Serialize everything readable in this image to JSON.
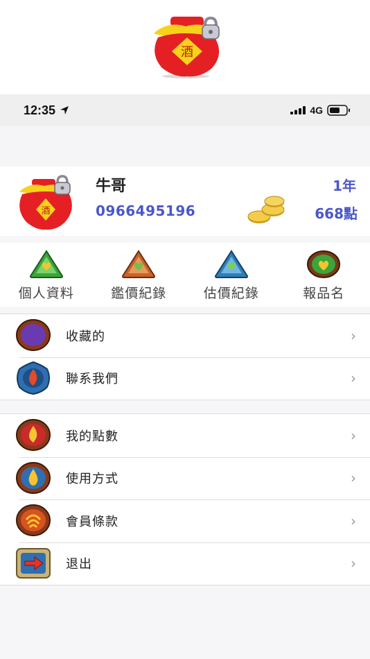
{
  "logo": {
    "glyph": "酒",
    "icon": "wine-jar-logo-icon"
  },
  "status_bar": {
    "time": "12:35",
    "network": "4G"
  },
  "profile": {
    "name": "牛哥",
    "membership": "1年",
    "phone": "0966495196",
    "points": "668點"
  },
  "quick_actions": [
    {
      "label": "個人資料",
      "icon": "green-triangle-badge-icon"
    },
    {
      "label": "鑑價紀錄",
      "icon": "orange-triangle-badge-icon"
    },
    {
      "label": "估價紀錄",
      "icon": "blue-triangle-badge-icon"
    },
    {
      "label": "報品名",
      "icon": "green-round-badge-icon"
    }
  ],
  "menu": {
    "group1": [
      {
        "label": "收藏的",
        "icon": "purple-moon-badge-icon"
      },
      {
        "label": "聯系我們",
        "icon": "blue-flame-badge-icon"
      }
    ],
    "group2": [
      {
        "label": "我的點數",
        "icon": "red-flame-badge-icon"
      },
      {
        "label": "使用方式",
        "icon": "blue-drop-badge-icon"
      },
      {
        "label": "會員條款",
        "icon": "orange-swirl-badge-icon"
      },
      {
        "label": "退出",
        "icon": "exit-arrow-icon"
      }
    ]
  },
  "colors": {
    "accent": "#4a57c9",
    "jar_red": "#e42025",
    "jar_gold": "#f6d21b"
  }
}
